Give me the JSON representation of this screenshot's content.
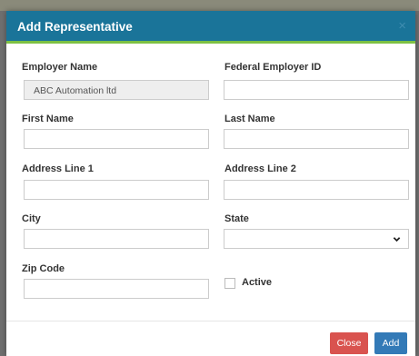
{
  "modal": {
    "title": "Add Representative",
    "close_icon": "close-icon"
  },
  "form": {
    "employer_name": {
      "label": "Employer Name",
      "value": "ABC Automation ltd",
      "placeholder": ""
    },
    "federal_employer_id": {
      "label": "Federal Employer ID",
      "value": ""
    },
    "first_name": {
      "label": "First Name",
      "value": ""
    },
    "last_name": {
      "label": "Last Name",
      "value": ""
    },
    "address_line_1": {
      "label": "Address Line 1",
      "value": ""
    },
    "address_line_2": {
      "label": "Address Line 2",
      "value": ""
    },
    "city": {
      "label": "City",
      "value": ""
    },
    "state": {
      "label": "State",
      "value": "",
      "icon": "chevron-down-icon"
    },
    "zip_code": {
      "label": "Zip Code",
      "value": ""
    },
    "active": {
      "label": "Active",
      "checked": false
    }
  },
  "footer": {
    "close_label": "Close",
    "add_label": "Add"
  },
  "colors": {
    "header": "#1a7499",
    "header_accent": "#7dc143",
    "close_button": "#d9534f",
    "add_button": "#337ab7"
  }
}
